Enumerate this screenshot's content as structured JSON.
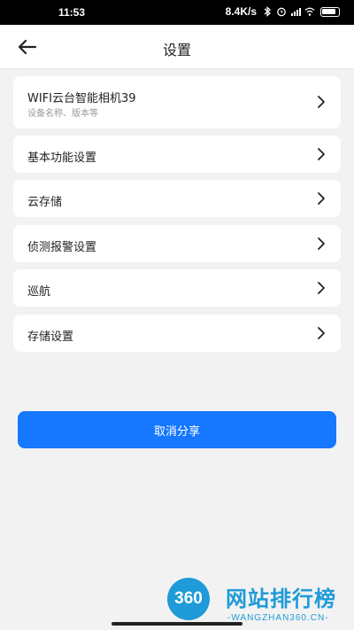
{
  "status_bar": {
    "time": "11:53",
    "speed": "8.4K/s",
    "icons": [
      "bluetooth-icon",
      "alarm-icon",
      "signal-icon",
      "wifi-icon",
      "battery-icon"
    ]
  },
  "nav": {
    "title": "设置",
    "back_icon": "arrow-left-icon"
  },
  "menu": {
    "device": {
      "label": "WIFI云台智能相机39",
      "sub": "设备名称、版本等"
    },
    "items": [
      {
        "label": "基本功能设置"
      },
      {
        "label": "云存储"
      },
      {
        "label": "侦测报警设置"
      },
      {
        "label": "巡航"
      },
      {
        "label": "存储设置"
      }
    ]
  },
  "share_button": {
    "label": "取消分享",
    "color": "#1677ff"
  },
  "watermark": {
    "logo_text": "360",
    "title": "网站排行榜",
    "subtitle": "-WANGZHAN360.CN-"
  }
}
